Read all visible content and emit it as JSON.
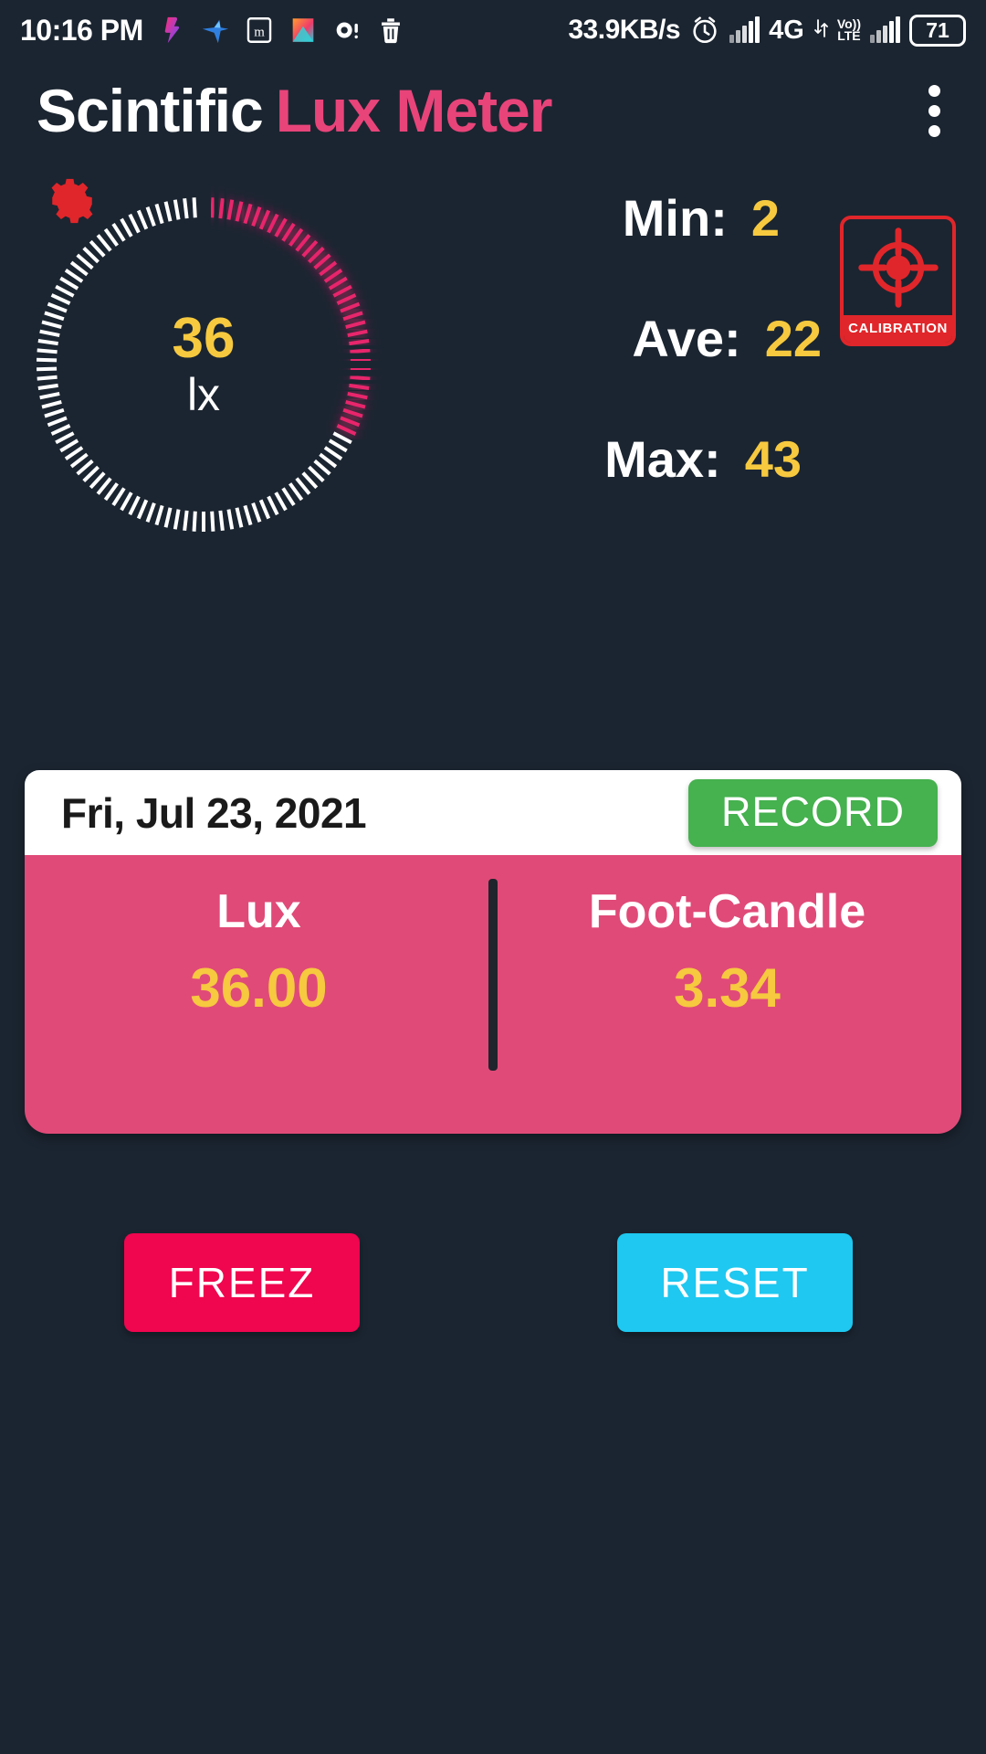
{
  "status_bar": {
    "time": "10:16 PM",
    "tray_icons": [
      "app-icon-pink",
      "app-icon-bird",
      "app-icon-m",
      "app-icon-gallery",
      "app-icon-camera",
      "trash-icon"
    ],
    "network_speed": "33.9KB/s",
    "alarm_icon": "alarm-clock-icon",
    "network_type": "4G",
    "volte_top": "Vo))",
    "volte_bottom": "LTE",
    "battery_level": "71"
  },
  "title_bar": {
    "title_part1": "Scintific",
    "title_part2": "Lux Meter",
    "overflow_icon": "overflow-menu-icon"
  },
  "gauge": {
    "settings_icon": "gear-icon",
    "value": "36",
    "unit": "lx",
    "total_ticks": 110,
    "active_ticks": 36,
    "inactive_color": "#ffffff",
    "active_color": "#e8266c",
    "start_angle_deg": -90,
    "sweep_deg": 330
  },
  "stats": {
    "min_label": "Min:",
    "min_value": "2",
    "ave_label": "Ave:",
    "ave_value": "22",
    "max_label": "Max:",
    "max_value": "43",
    "label_color": "#ffffff",
    "value_color": "#f6c93f"
  },
  "calibration": {
    "label": "CALIBRATION",
    "icon": "crosshair-target-icon",
    "color": "#e0262a"
  },
  "record_card": {
    "date": "Fri, Jul 23, 2021",
    "record_button": "RECORD",
    "record_button_color": "#45b14f",
    "panel_color": "#e04a78",
    "lux_label": "Lux",
    "lux_value": "36.00",
    "fc_label": "Foot-Candle",
    "fc_value": "3.34",
    "value_color": "#f6c93f"
  },
  "actions": {
    "freez_label": "FREEZ",
    "freez_color": "#f0054f",
    "reset_label": "RESET",
    "reset_color": "#1ec8f0"
  },
  "theme": {
    "background": "#1b2531",
    "accent_pink": "#e8447a",
    "accent_yellow": "#f6c93f"
  }
}
